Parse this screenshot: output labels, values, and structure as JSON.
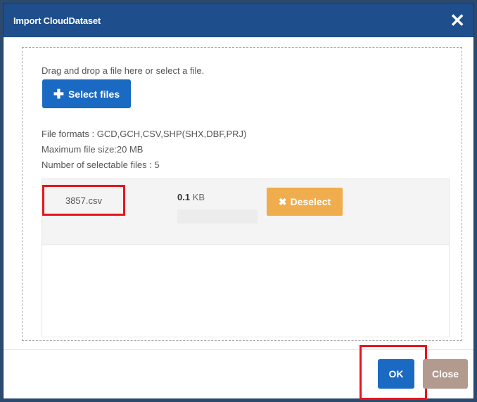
{
  "dialog": {
    "title": "Import CloudDataset",
    "close_icon": "close-icon"
  },
  "upload": {
    "drag_text": "Drag and drop a file here or select a file.",
    "select_button_icon": "plus-icon",
    "select_button_label": "Select files",
    "formats": "File formats : GCD,GCH,CSV,SHP(SHX,DBF,PRJ)",
    "max_size": "Maximum file size:20 MB",
    "max_files": "Number of selectable files : 5"
  },
  "files": [
    {
      "name": "3857.csv",
      "size_value": "0.1",
      "size_unit": "KB",
      "progress": 0,
      "deselect_icon": "x-icon",
      "deselect_label": "Deselect"
    }
  ],
  "footer": {
    "ok_label": "OK",
    "close_label": "Close"
  },
  "colors": {
    "title_bar": "#1f4e8c",
    "primary": "#1a6ac3",
    "warning": "#f0ad4e",
    "highlight": "#e8141b",
    "close_button": "#b39a8f"
  }
}
